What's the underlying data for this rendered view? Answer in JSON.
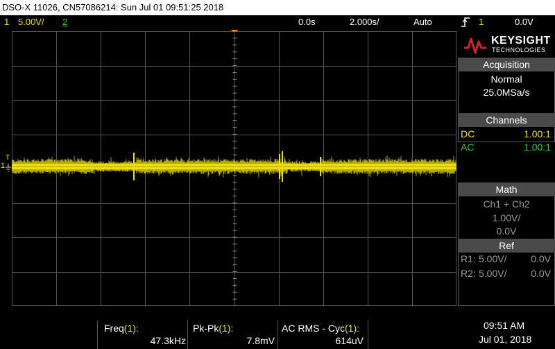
{
  "title": "DSO-X 11026, CN57086214: Sun Jul 01 09:51:25 2018",
  "status": {
    "ch1_num": "1",
    "ch1_scale": "5.00V/",
    "ch2_num": "2",
    "time_ref": "0.0s",
    "time_scale": "2.000s/",
    "trigger_mode": "Auto",
    "trigger_icon": "rising-edge-icon",
    "trigger_ch": "1",
    "trigger_level": "0.0V"
  },
  "brand": {
    "name": "KEYSIGHT",
    "sub": "TECHNOLOGIES",
    "color": "#d1202f"
  },
  "acquisition": {
    "header": "Acquisition",
    "mode": "Normal",
    "rate": "25.0MSa/s"
  },
  "channels": {
    "header": "Channels",
    "rows": [
      {
        "coupling": "DC",
        "ratio": "1.00:1",
        "color": "#f2e400"
      },
      {
        "coupling": "AC",
        "ratio": "1.00:1",
        "color": "#21d521"
      }
    ]
  },
  "math": {
    "header": "Math",
    "func": "Ch1 + Ch2",
    "scale": "1.00V/",
    "offset": "0.0V"
  },
  "ref": {
    "header": "Ref",
    "rows": [
      {
        "name": "R1:",
        "scale": "5.00V/",
        "offset": "0.0V"
      },
      {
        "name": "R2:",
        "scale": "5.00V/",
        "offset": "0.0V"
      }
    ]
  },
  "measurements": [
    {
      "label": "Freq",
      "src": "(1):",
      "value": "47.3kHz"
    },
    {
      "label": "Pk-Pk",
      "src": "(1):",
      "value": "7.8mV"
    },
    {
      "label": "AC RMS - Cyc",
      "src": "(1):",
      "value": "614uV"
    }
  ],
  "clock": {
    "time": "09:51 AM",
    "date": "Jul 01, 2018"
  },
  "ground_marker": "1",
  "trigger_marker_label": "T",
  "colors": {
    "ch1": "#f2e400",
    "ch2": "#21d521",
    "trigger": "#ff8c00",
    "grid": "#555555"
  }
}
